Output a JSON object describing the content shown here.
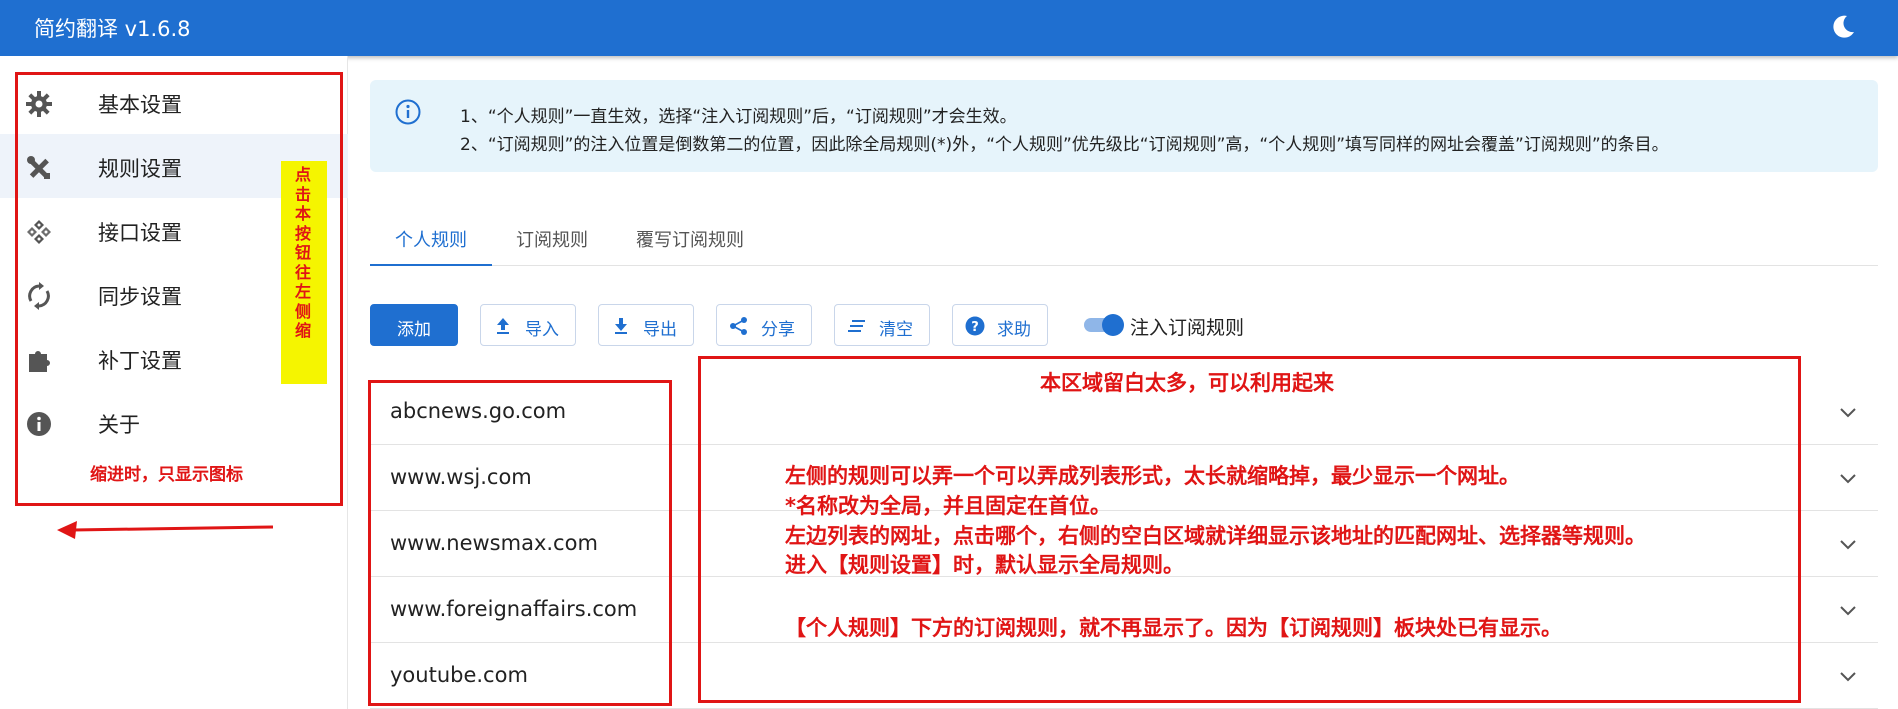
{
  "app": {
    "title": "简约翻译 v1.6.8",
    "accent": "#1f6fd0",
    "theme_icon": "moon-icon"
  },
  "sidebar": {
    "items": [
      {
        "label": "基本设置",
        "icon": "gear-icon",
        "active": false
      },
      {
        "label": "规则设置",
        "icon": "tools-icon",
        "active": true
      },
      {
        "label": "接口设置",
        "icon": "api-icon",
        "active": false
      },
      {
        "label": "同步设置",
        "icon": "sync-icon",
        "active": false
      },
      {
        "label": "补丁设置",
        "icon": "extension-icon",
        "active": false
      },
      {
        "label": "关于",
        "icon": "info-icon",
        "active": false
      }
    ]
  },
  "notice": {
    "line1": "1、“个人规则”一直生效，选择“注入订阅规则”后，“订阅规则”才会生效。",
    "line2": "2、“订阅规则”的注入位置是倒数第二的位置，因此除全局规则(*)外，“个人规则”优先级比“订阅规则”高，“个人规则”填写同样的网址会覆盖”订阅规则”的条目。"
  },
  "tabs": [
    {
      "label": "个人规则",
      "active": true
    },
    {
      "label": "订阅规则",
      "active": false
    },
    {
      "label": "覆写订阅规则",
      "active": false
    }
  ],
  "toolbar": {
    "add": "添加",
    "import": "导入",
    "export": "导出",
    "share": "分享",
    "clear": "清空",
    "help": "求助",
    "inject_label": "注入订阅规则",
    "inject_on": true
  },
  "rules": [
    {
      "url": "abcnews.go.com"
    },
    {
      "url": "www.wsj.com"
    },
    {
      "url": "www.newsmax.com"
    },
    {
      "url": "www.foreignaffairs.com"
    },
    {
      "url": "youtube.com"
    }
  ],
  "annotations": {
    "collapse_hint": "点击本按钮往左侧缩",
    "indent_note": "缩进时，只显示图标",
    "blank_area": "本区域留白太多，可以利用起来",
    "note1": "左侧的规则可以弄一个可以弄成列表形式，太长就缩略掉，最少显示一个网址。",
    "note2": "*名称改为全局，并且固定在首位。",
    "note3": "左边列表的网址，点击哪个，右侧的空白区域就详细显示该地址的匹配网址、选择器等规则。",
    "note4": "进入【规则设置】时，默认显示全局规则。",
    "note5": "【个人规则】下方的订阅规则，就不再显示了。因为【订阅规则】板块处已有显示。",
    "color": "#e01515",
    "highlight": "#f5f500"
  }
}
